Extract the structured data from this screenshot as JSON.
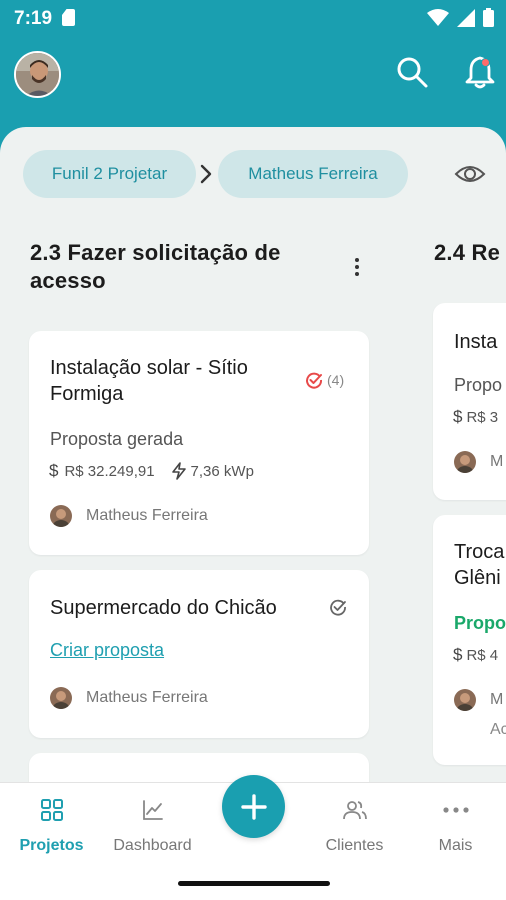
{
  "status_bar": {
    "time": "7:19"
  },
  "header": {
    "avatar_alt": "user avatar"
  },
  "filters": {
    "funnel": "Funil 2 Projetar",
    "user": "Matheus Ferreira"
  },
  "columns": [
    {
      "title": "2.3 Fazer solicitação de acesso",
      "cards": [
        {
          "title": "Instalação solar - Sítio Formiga",
          "check_count": "(4)",
          "status": "Proposta gerada",
          "price": "R$ 32.249,91",
          "power": "7,36 kWp",
          "user": "Matheus Ferreira"
        },
        {
          "title": "Supermercado do Chicão",
          "status": "Criar proposta",
          "user": "Matheus Ferreira"
        }
      ]
    },
    {
      "title": "2.4 Re",
      "cards": [
        {
          "title": "Insta",
          "status": "Propo",
          "price": "R$ 3",
          "user": "M"
        },
        {
          "title_line1": "Troca",
          "title_line2": "Glêni",
          "status": "Propo",
          "price": "R$ 4",
          "user": "M",
          "extra": "Ac"
        }
      ]
    }
  ],
  "bottom_nav": [
    {
      "label": "Projetos",
      "icon": "grid-icon",
      "active": true
    },
    {
      "label": "Dashboard",
      "icon": "chart-icon",
      "active": false
    },
    {
      "label": "Clientes",
      "icon": "people-icon",
      "active": false
    },
    {
      "label": "Mais",
      "icon": "more-dots-icon",
      "active": false
    }
  ],
  "colors": {
    "primary": "#1a9fb0",
    "background": "#eef2f1",
    "status_green": "#1aa86a",
    "check_red": "#e84a4a"
  }
}
